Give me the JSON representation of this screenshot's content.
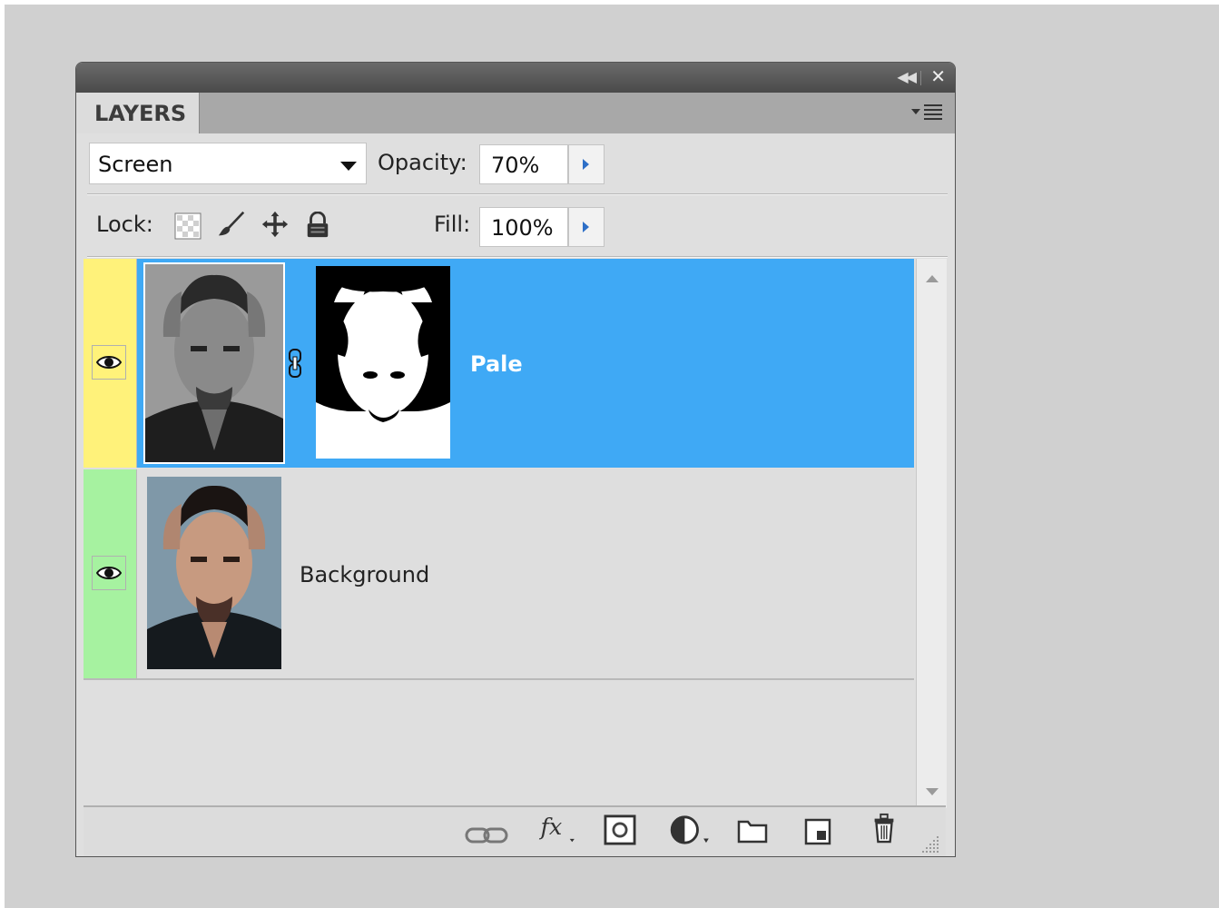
{
  "panel": {
    "tab_label": "LAYERS",
    "blend_mode": "Screen",
    "opacity_label": "Opacity:",
    "opacity_value": "70%",
    "lock_label": "Lock:",
    "fill_label": "Fill:",
    "fill_value": "100%"
  },
  "layers": [
    {
      "name": "Pale",
      "selected": true,
      "visible": true,
      "label_color": "#fff27a",
      "has_mask": true,
      "linked_mask": true
    },
    {
      "name": "Background",
      "selected": false,
      "visible": true,
      "label_color": "#a6f2a0",
      "has_mask": false
    }
  ],
  "colors": {
    "selection": "#3fa9f5",
    "panel_bg": "#dfdfdf",
    "titlebar": "#4a4a4a"
  },
  "icons": {
    "titlebar": [
      "collapse-icon",
      "close-icon"
    ],
    "panel_menu": "panel-menu-icon",
    "locks": [
      "lock-transparent-icon",
      "lock-image-icon",
      "lock-position-icon",
      "lock-all-icon"
    ],
    "bottom": [
      "link-layers-icon",
      "fx-icon",
      "add-mask-icon",
      "adjustment-layer-icon",
      "new-group-icon",
      "new-layer-icon",
      "delete-layer-icon"
    ]
  }
}
